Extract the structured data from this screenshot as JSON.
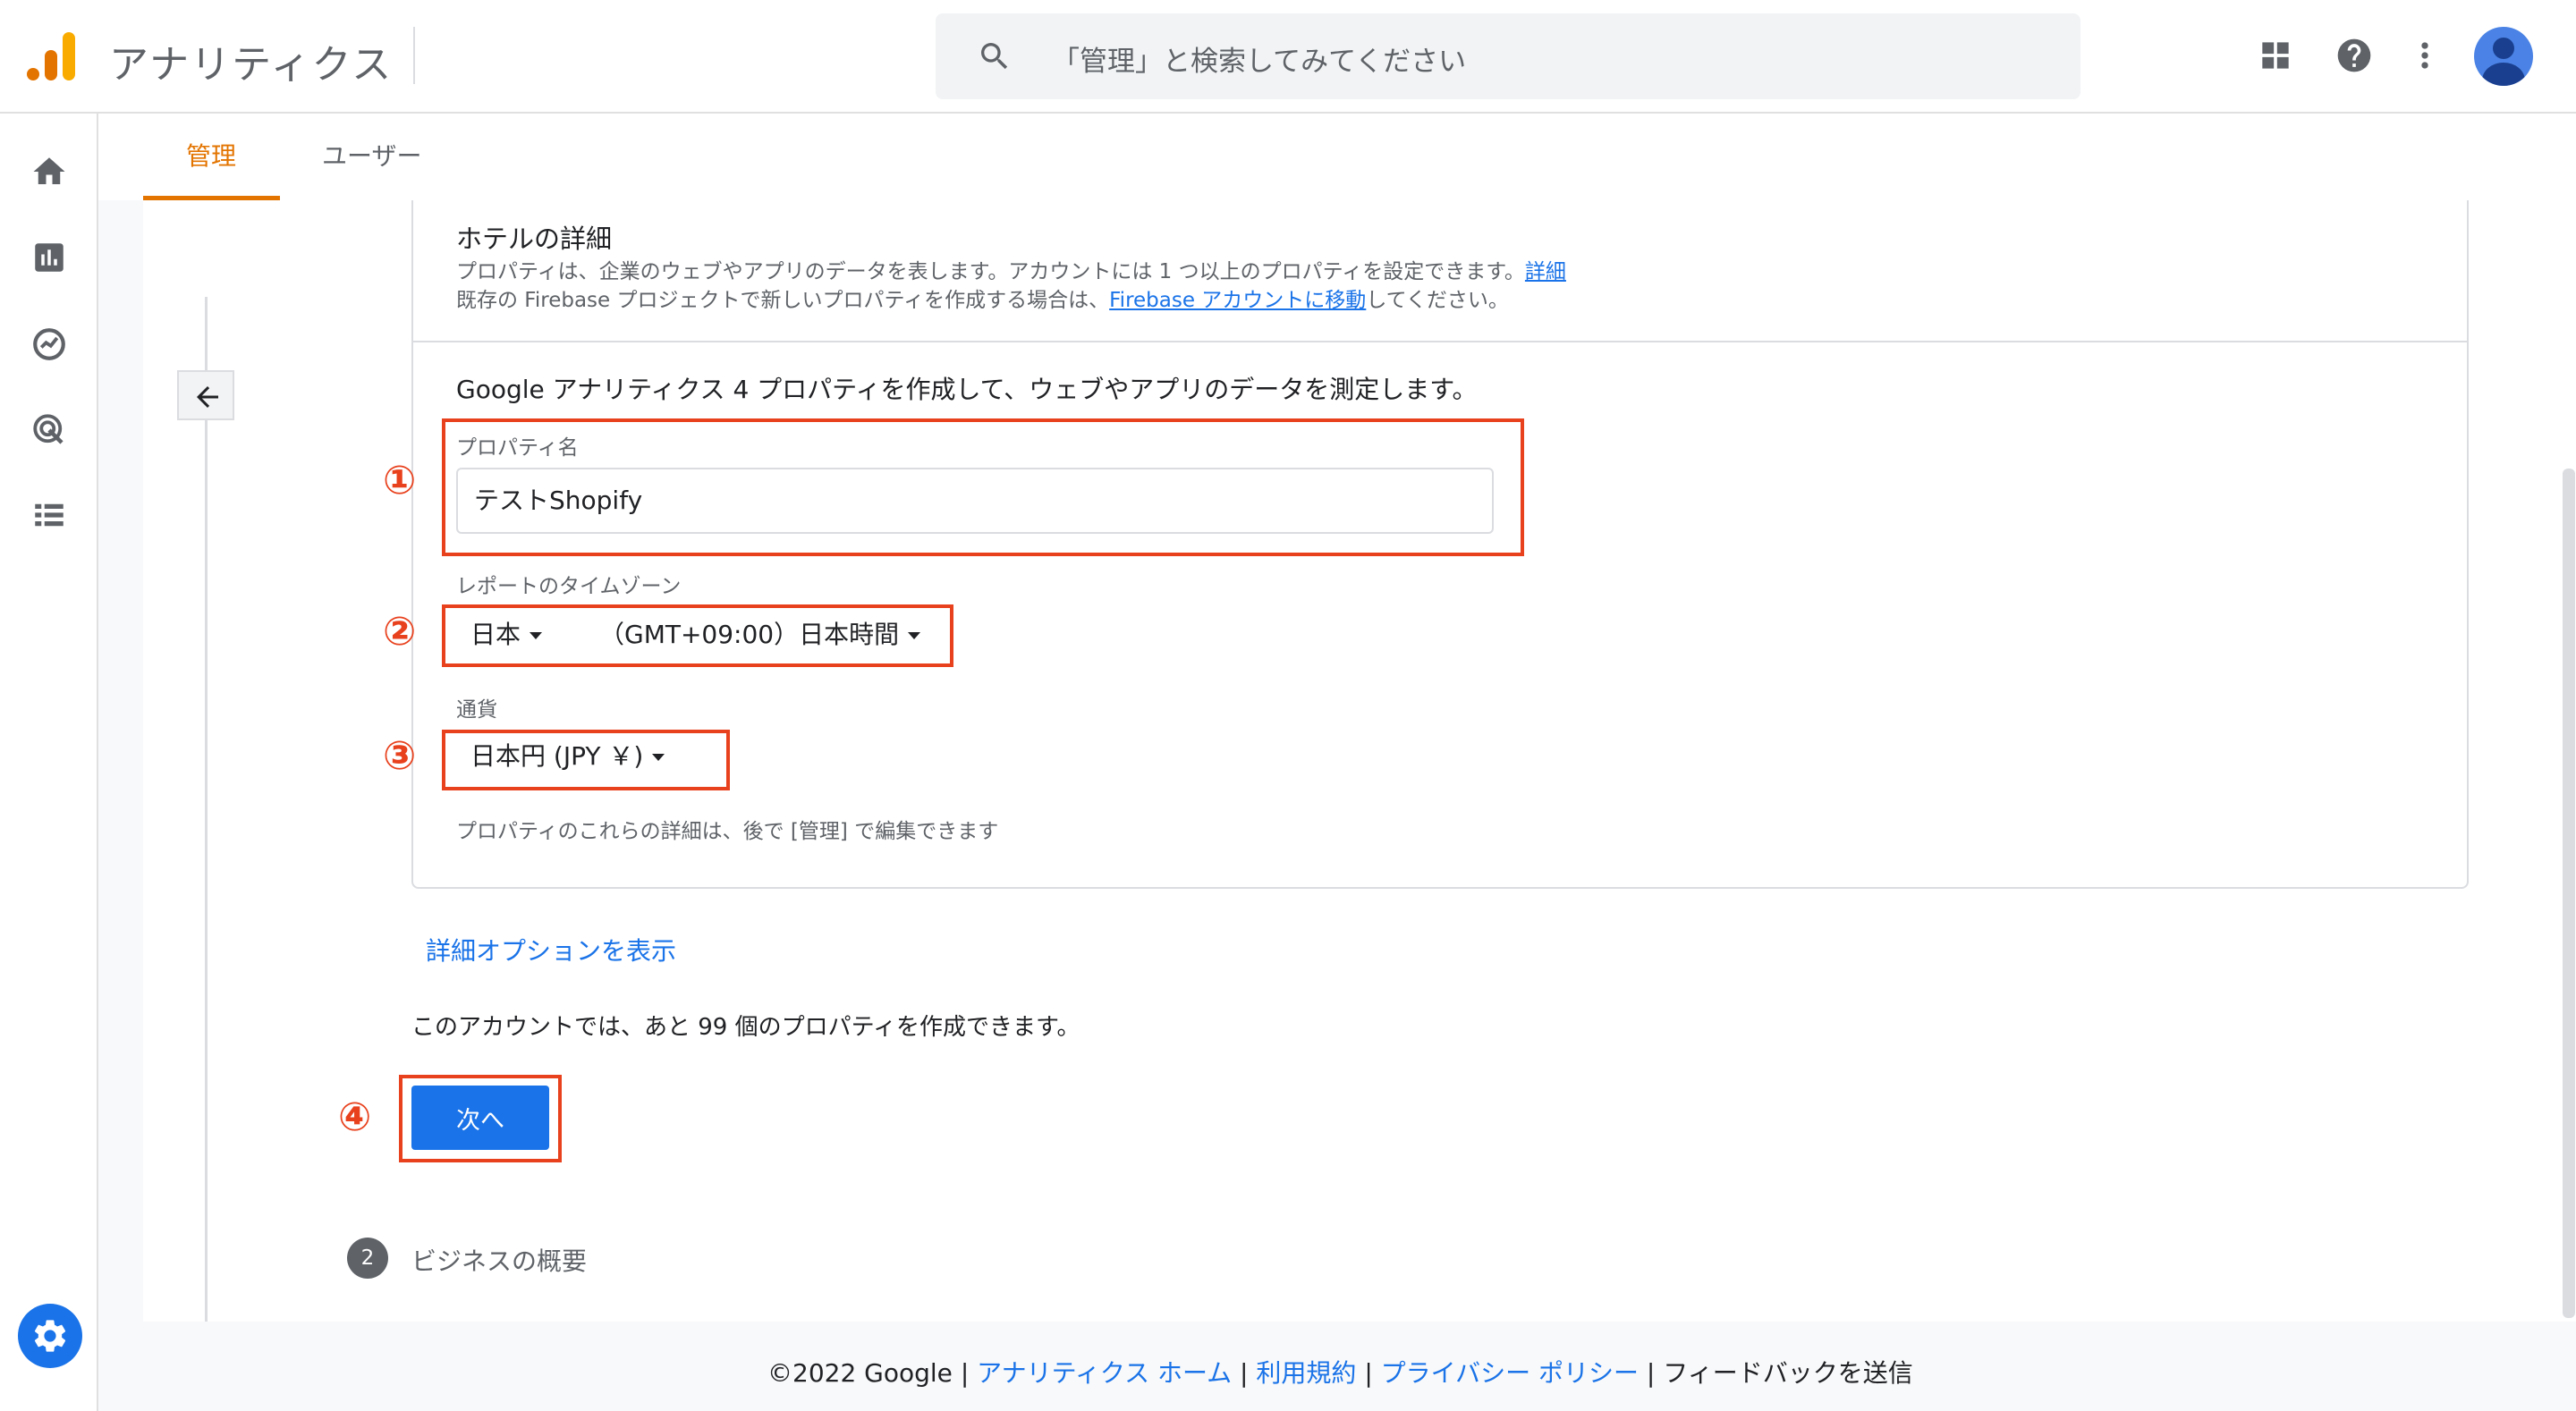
{
  "app": {
    "title": "アナリティクス"
  },
  "search": {
    "placeholder": "「管理」と検索してみてください"
  },
  "tabs": [
    {
      "label": "管理"
    },
    {
      "label": "ユーザー"
    }
  ],
  "property": {
    "partial_title": "ホテルの詳細",
    "desc_line1": "プロパティは、企業のウェブやアプリのデータを表します。アカウントには 1 つ以上のプロパティを設定できます。",
    "desc_line1_link": "詳細",
    "desc_line2_prefix": "既存の Firebase プロジェクトで新しいプロパティを作成する場合は、",
    "desc_line2_link": "Firebase アカウントに移動",
    "desc_line2_suffix": "してください。",
    "intro": "Google アナリティクス 4 プロパティを作成して、ウェブやアプリのデータを測定します。",
    "name_label": "プロパティ名",
    "name_value": "テストShopify",
    "timezone_label": "レポートのタイムゾーン",
    "timezone_country": "日本",
    "timezone_value": "（GMT+09:00）日本時間",
    "currency_label": "通貨",
    "currency_value": "日本円 (JPY ￥)",
    "note": "プロパティのこれらの詳細は、後で [管理] で編集できます"
  },
  "advanced_link": "詳細オプションを表示",
  "remaining_text": "このアカウントでは、あと 99 個のプロパティを作成できます。",
  "next_button": "次へ",
  "step2": {
    "number": "2",
    "label": "ビジネスの概要"
  },
  "markers": [
    "①",
    "②",
    "③",
    "④"
  ],
  "footer": {
    "copyright": "©2022 Google",
    "links": [
      "アナリティクス ホーム",
      "利用規約",
      "プライバシー ポリシー"
    ],
    "separator": "|",
    "feedback": "フィードバックを送信"
  },
  "colors": {
    "accent": "#e37400",
    "link": "#1a73e8",
    "annotation": "#e8411d"
  }
}
